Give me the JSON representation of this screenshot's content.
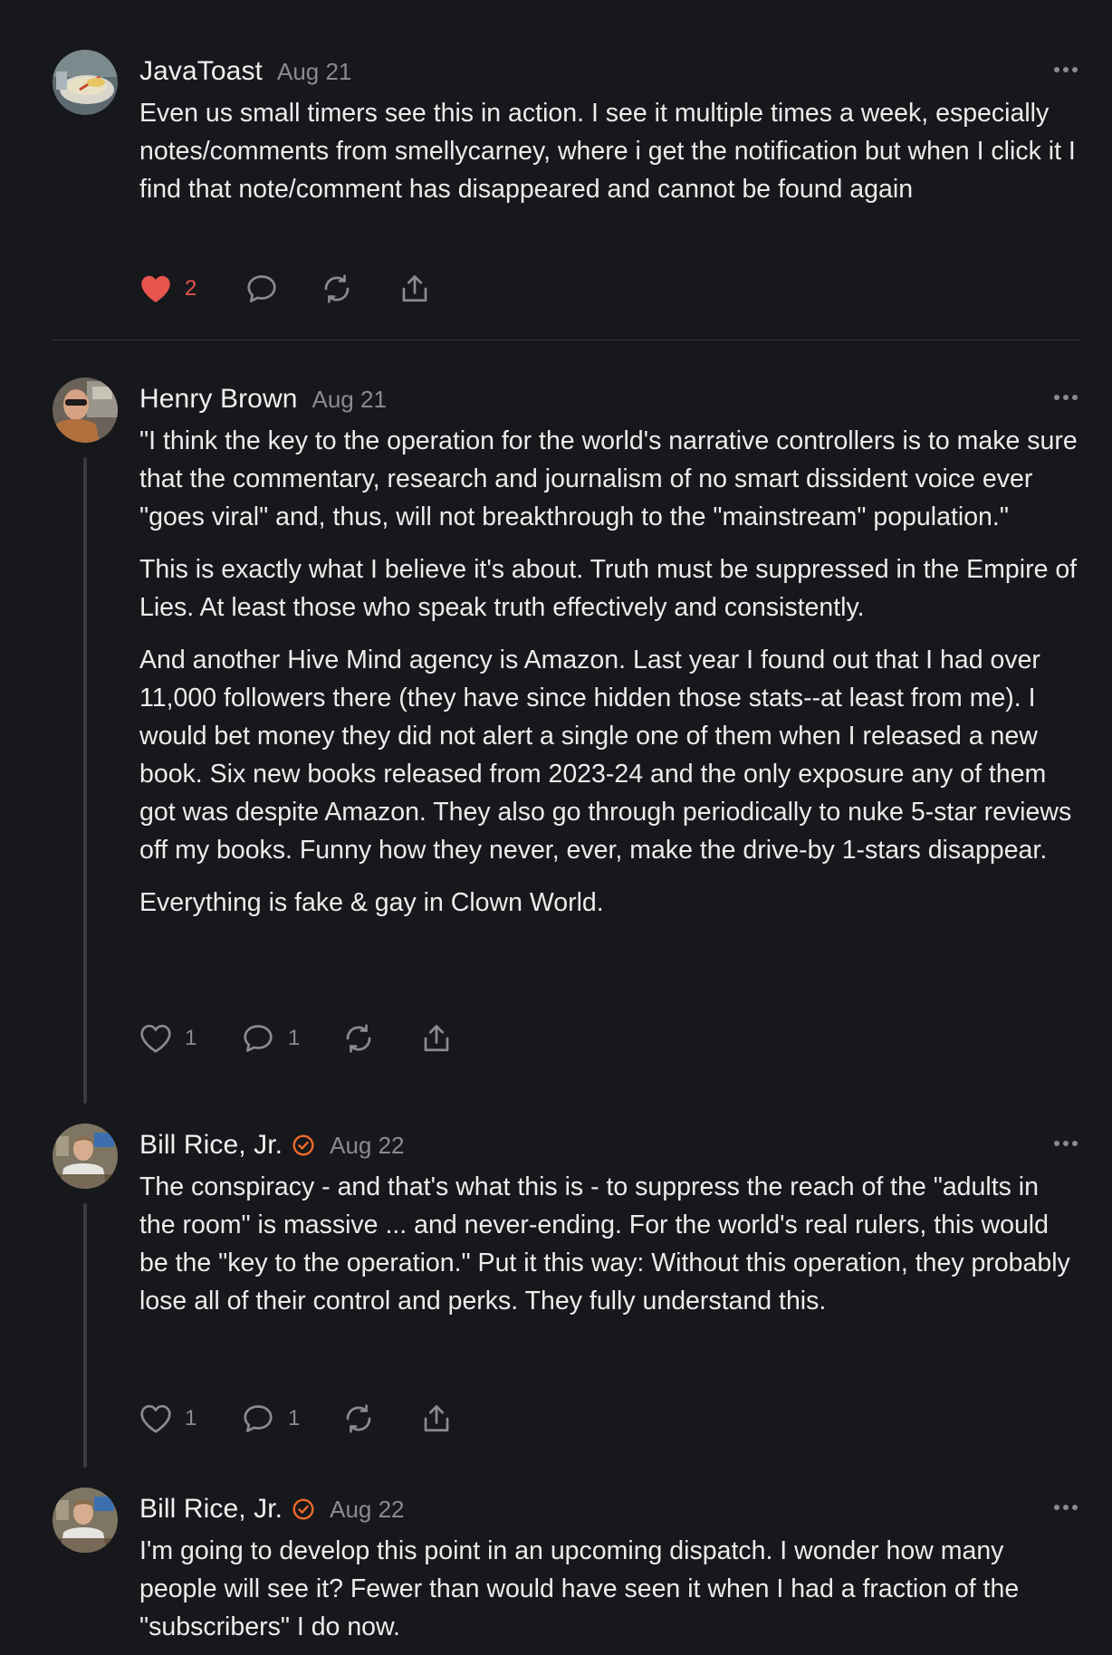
{
  "colors": {
    "background": "#17181b",
    "text": "#ececec",
    "muted": "#8a8b90",
    "like_active": "#e8544e",
    "verified": "#f06a2b",
    "thread_line": "#3a3b3f"
  },
  "comments": [
    {
      "author": "JavaToast",
      "date": "Aug 21",
      "verified": false,
      "paragraphs": [
        "Even us small timers see this in action. I see it multiple times a week, especially notes/comments from smellycarney, where i get the notification but when I click it I find that note/comment has disappeared and cannot be found again"
      ],
      "likes": "2",
      "liked": true,
      "replies": ""
    },
    {
      "author": "Henry Brown",
      "date": "Aug 21",
      "verified": false,
      "paragraphs": [
        "\"I think the key to the operation for the world's narrative controllers is to make sure that the commentary, research and journalism of no smart dissident voice ever \"goes viral\" and, thus, will not breakthrough to the \"mainstream\" population.\"",
        "This is exactly what I believe it's about. Truth must be suppressed in the Empire of Lies. At least those who speak truth effectively and consistently.",
        "And another Hive Mind agency is Amazon. Last year I found out that I had over 11,000 followers there (they have since hidden those stats--at least from me). I would bet money they did not alert a single one of them when I released a new book. Six new books released from 2023-24 and the only exposure any of them got was despite Amazon. They also go through periodically to nuke 5-star reviews off my books. Funny how they never, ever, make the drive-by 1-stars disappear.",
        "Everything is fake & gay in Clown World."
      ],
      "likes": "1",
      "liked": false,
      "replies": "1"
    },
    {
      "author": "Bill Rice, Jr.",
      "date": "Aug 22",
      "verified": true,
      "paragraphs": [
        "The conspiracy - and that's what this is - to suppress the reach of the \"adults in the room\" is massive ... and never-ending. For the world's real rulers, this would be the \"key to the operation.\" Put it this way: Without this operation, they probably lose all of their control and perks. They fully understand this."
      ],
      "likes": "1",
      "liked": false,
      "replies": "1"
    },
    {
      "author": "Bill Rice, Jr.",
      "date": "Aug 22",
      "verified": true,
      "paragraphs": [
        "I'm going to develop this point in an upcoming dispatch. I wonder how many people will see it? Fewer than would have seen it when I had a fraction of the \"subscribers\" I do now."
      ]
    }
  ],
  "icons": {
    "like": "heart-icon",
    "reply": "speech-bubble-icon",
    "restack": "refresh-icon",
    "share": "share-icon",
    "more": "ellipsis-icon",
    "verified": "check-badge-icon"
  }
}
